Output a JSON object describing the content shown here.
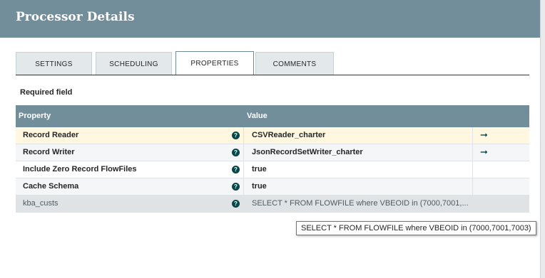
{
  "dialog": {
    "title": "Processor Details"
  },
  "tabs": [
    {
      "label": "SETTINGS"
    },
    {
      "label": "SCHEDULING"
    },
    {
      "label": "PROPERTIES",
      "active": true
    },
    {
      "label": "COMMENTS"
    }
  ],
  "required_label": "Required field",
  "grid": {
    "headers": {
      "property": "Property",
      "value": "Value"
    },
    "rows": [
      {
        "property": "Record Reader",
        "value": "CSVReader_charter",
        "has_link": true,
        "link_icon": "arrow-right-icon"
      },
      {
        "property": "Record Writer",
        "value": "JsonRecordSetWriter_charter",
        "has_link": true,
        "link_icon": "arrow-right-icon"
      },
      {
        "property": "Include Zero Record FlowFiles",
        "value": "true",
        "has_link": false
      },
      {
        "property": "Cache Schema",
        "value": "true",
        "has_link": false
      },
      {
        "property": "kba_custs",
        "value": "SELECT * FROM FLOWFILE where VBEOID in (7000,7001,...",
        "has_link": false
      }
    ],
    "help_glyph": "?",
    "link_glyph": "➞"
  },
  "tooltip": {
    "text": "SELECT * FROM FLOWFILE where VBEOID in (7000,7001,7003)"
  },
  "colors": {
    "header": "#728e9b",
    "accent": "#004849",
    "selected_row": "#fff7e0",
    "tab_bg": "#e3e8eb"
  }
}
